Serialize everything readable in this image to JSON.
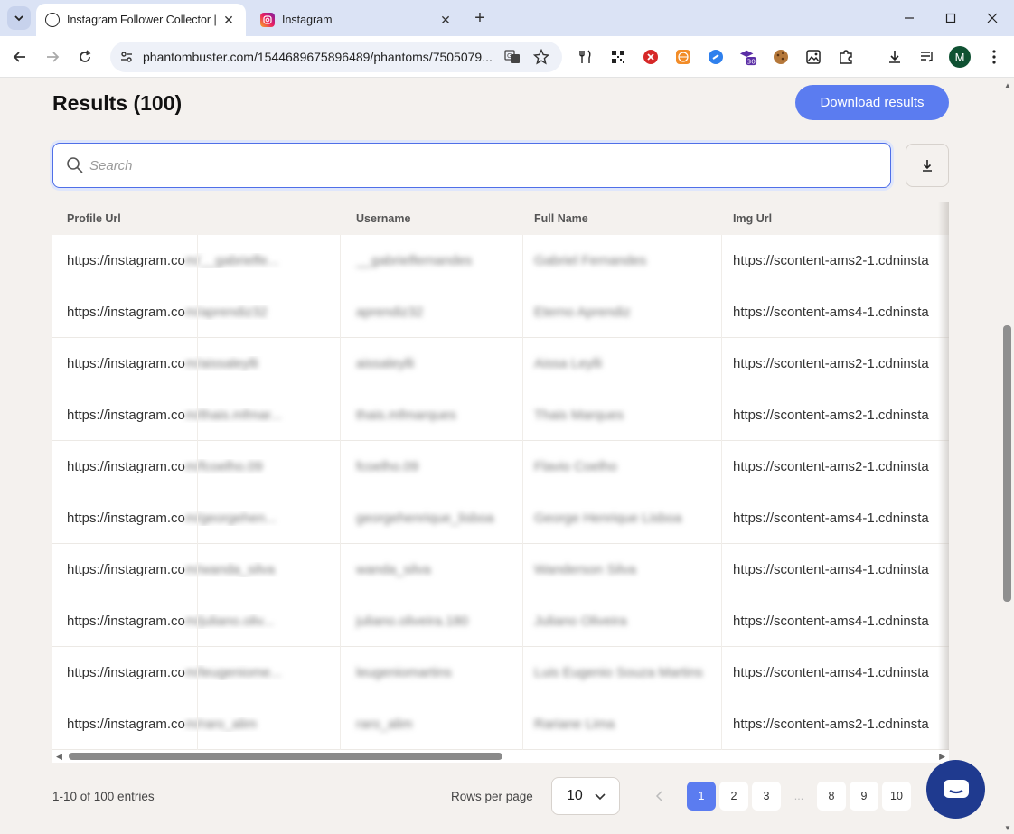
{
  "browser": {
    "tabs": [
      {
        "title": "Instagram Follower Collector | P",
        "active": true
      },
      {
        "title": "Instagram",
        "active": false
      }
    ],
    "url": "phantombuster.com/1544689675896489/phantoms/7505079...",
    "extension_badge": "30",
    "profile_initial": "M"
  },
  "page": {
    "title": "Results (100)",
    "download_label": "Download results",
    "search_placeholder": "Search"
  },
  "table": {
    "columns": [
      "Profile Url",
      "Username",
      "Full Name",
      "Img Url"
    ],
    "rows": [
      {
        "profile": "https://instagram.com/__gabrielfe...",
        "username": "__gabrielfernandes",
        "fullname": "Gabriel Fernandes",
        "img": "https://scontent-ams2-1.cdninsta"
      },
      {
        "profile": "https://instagram.com/aprendiz32",
        "username": "aprendiz32",
        "fullname": "Eterno Aprendiz",
        "img": "https://scontent-ams4-1.cdninsta"
      },
      {
        "profile": "https://instagram.com/aissaleylli",
        "username": "aissaleylli",
        "fullname": "Aissa Leylli",
        "img": "https://scontent-ams2-1.cdninsta"
      },
      {
        "profile": "https://instagram.com/thais.mfmar...",
        "username": "thais.mfmarques",
        "fullname": "Thais Marques",
        "img": "https://scontent-ams2-1.cdninsta"
      },
      {
        "profile": "https://instagram.com/fcoelho.09",
        "username": "fcoelho.09",
        "fullname": "Flavio Coelho",
        "img": "https://scontent-ams2-1.cdninsta"
      },
      {
        "profile": "https://instagram.com/georgehen...",
        "username": "georgehenrique_lisboa",
        "fullname": "George Henrique Lisboa",
        "img": "https://scontent-ams4-1.cdninsta"
      },
      {
        "profile": "https://instagram.com/wanda_silva",
        "username": "wanda_silva",
        "fullname": "Wanderson Silva",
        "img": "https://scontent-ams4-1.cdninsta"
      },
      {
        "profile": "https://instagram.com/juliano.oliv...",
        "username": "juliano.oliveira.180",
        "fullname": "Juliano Oliveira",
        "img": "https://scontent-ams4-1.cdninsta"
      },
      {
        "profile": "https://instagram.com/leugeniome...",
        "username": "leugeniomartins",
        "fullname": "Luis Eugenio Souza Martins",
        "img": "https://scontent-ams4-1.cdninsta"
      },
      {
        "profile": "https://instagram.com/raro_alim",
        "username": "raro_alim",
        "fullname": "Rariane Lima",
        "img": "https://scontent-ams2-1.cdninsta"
      }
    ]
  },
  "pagination": {
    "entries_text": "1-10 of 100 entries",
    "rows_per_page_label": "Rows per page",
    "rows_per_page_value": "10",
    "pages": [
      "1",
      "2",
      "3",
      "8",
      "9",
      "10"
    ],
    "ellipsis": "...",
    "current_page": "1"
  },
  "colors": {
    "accent": "#5b7cf0",
    "chat": "#1f3a8f",
    "page_bg": "#f4f1ee"
  }
}
